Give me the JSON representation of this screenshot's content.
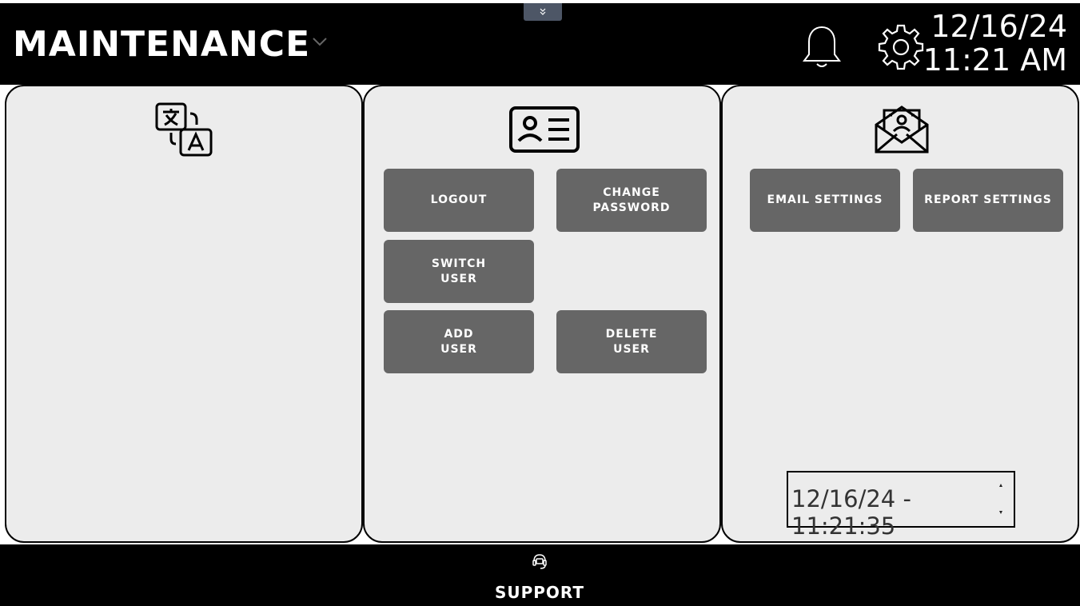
{
  "header": {
    "title": "MAINTENANCE",
    "date": "12/16/24",
    "time": "11:21 AM",
    "icons": [
      "chevron-double-down-icon",
      "chevron-down-icon",
      "bell-icon",
      "gear-icon"
    ]
  },
  "panels": {
    "language": {
      "icon": "translate-icon"
    },
    "user": {
      "icon": "user-card-icon",
      "buttons": {
        "logout": "LOGOUT",
        "change_password": "CHANGE\nPASSWORD",
        "switch_user": "SWITCH\nUSER",
        "add_user": "ADD\nUSER",
        "delete_user": "DELETE\nUSER"
      }
    },
    "email": {
      "icon": "email-envelope-icon",
      "buttons": {
        "email_settings": "EMAIL SETTINGS",
        "report_settings": "REPORT SETTINGS"
      },
      "datetime_value": "12/16/24 - 11:21:35"
    }
  },
  "footer": {
    "support_label": "SUPPORT",
    "support_icon": "headset-icon"
  },
  "colors": {
    "bar": "#000000",
    "panel": "#ececec",
    "button": "#666666",
    "pull_tab": "#4d5666"
  }
}
